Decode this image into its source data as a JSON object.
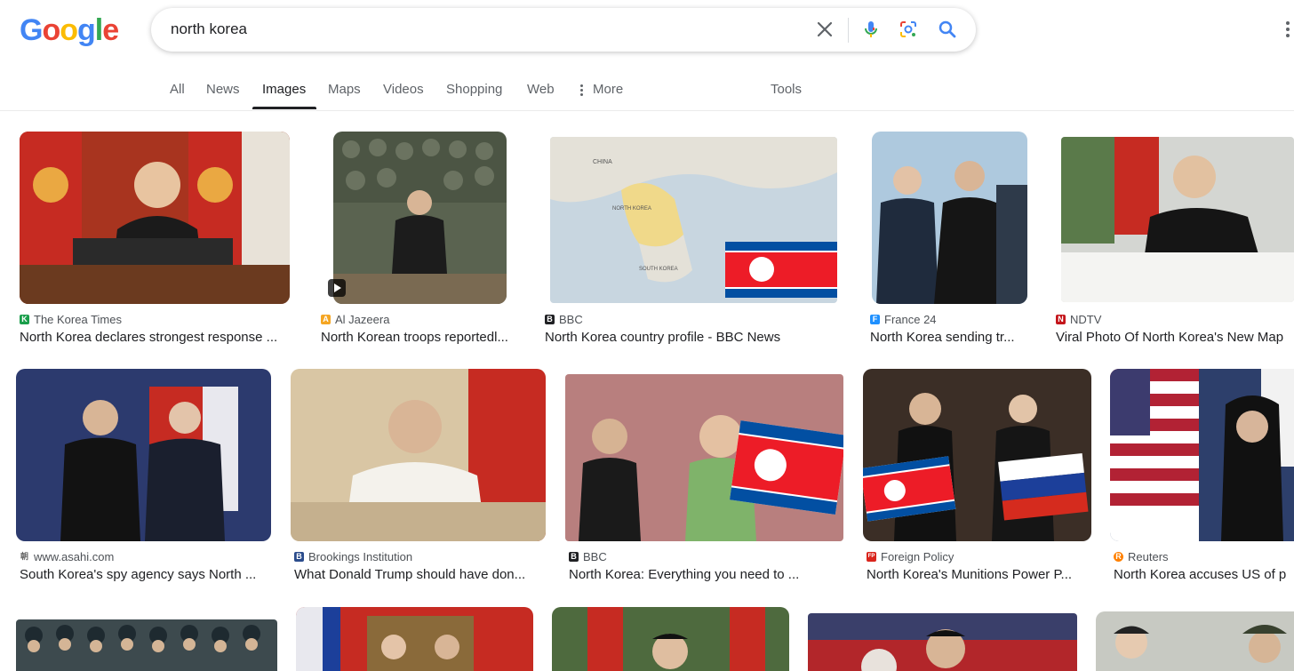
{
  "search": {
    "query": "north korea"
  },
  "logo": {
    "letters": [
      "G",
      "o",
      "o",
      "g",
      "l",
      "e"
    ]
  },
  "tabs": [
    {
      "label": "All"
    },
    {
      "label": "News"
    },
    {
      "label": "Images"
    },
    {
      "label": "Maps"
    },
    {
      "label": "Videos"
    },
    {
      "label": "Shopping"
    },
    {
      "label": "Web"
    },
    {
      "label": "More"
    },
    {
      "label": "Tools"
    }
  ],
  "active_tab": "Images",
  "colors": {
    "google_blue": "#4285F4",
    "google_red": "#EA4335",
    "google_yellow": "#FBBC05",
    "google_green": "#34A853"
  },
  "icons": [
    "clear-icon",
    "microphone-icon",
    "lens-camera-icon",
    "search-icon",
    "more-vert-icon",
    "more-dots-icon",
    "play-icon"
  ],
  "results": [
    {
      "source": "The Korea Times",
      "title": "North Korea declares strongest response ...",
      "favicon_color": "#1a9e4b",
      "favicon_letter": "K"
    },
    {
      "source": "Al Jazeera",
      "title": "North Korean troops reportedl...",
      "favicon_color": "#f5a623",
      "favicon_letter": "A",
      "video": true
    },
    {
      "source": "BBC",
      "title": "North Korea country profile - BBC News",
      "favicon_color": "#202124",
      "favicon_letter": "B"
    },
    {
      "source": "France 24",
      "title": "North Korea sending tr...",
      "favicon_color": "#1e90ff",
      "favicon_letter": "F"
    },
    {
      "source": "NDTV",
      "title": "Viral Photo Of North Korea's New Map",
      "favicon_color": "#c4161c",
      "favicon_letter": "N"
    },
    {
      "source": "www.asahi.com",
      "title": "South Korea's spy agency says North ...",
      "favicon_color": "#666666",
      "favicon_letter": "朝"
    },
    {
      "source": "Brookings Institution",
      "title": "What Donald Trump should have don...",
      "favicon_color": "#2b4c8c",
      "favicon_letter": "B"
    },
    {
      "source": "BBC",
      "title": "North Korea: Everything you need to ...",
      "favicon_color": "#202124",
      "favicon_letter": "B"
    },
    {
      "source": "Foreign Policy",
      "title": "North Korea's Munitions Power P...",
      "favicon_color": "#d9241c",
      "favicon_letter": "FP"
    },
    {
      "source": "Reuters",
      "title": "North Korea accuses US of p",
      "favicon_color": "#ff8000",
      "favicon_letter": "R"
    }
  ]
}
